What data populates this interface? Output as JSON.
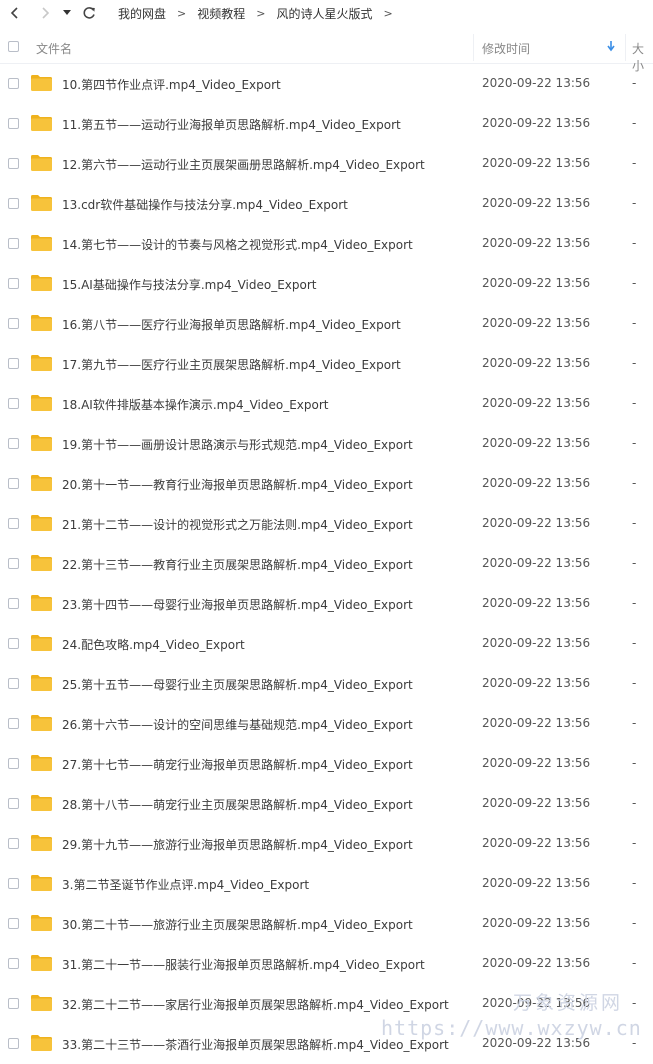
{
  "toolbar": {
    "back_icon": "chevron-left-icon",
    "forward_icon": "chevron-right-icon",
    "dropdown_icon": "caret-down-icon",
    "refresh_icon": "refresh-icon"
  },
  "breadcrumb": {
    "items": [
      "我的网盘",
      "视频教程",
      "风的诗人星火版式"
    ],
    "separator": ">"
  },
  "table": {
    "headers": {
      "name": "文件名",
      "time": "修改时间",
      "size": "大小"
    },
    "sort_icon": "sort-down-arrow-icon",
    "rows": [
      {
        "name": "10.第四节作业点评.mp4_Video_Export",
        "time": "2020-09-22 13:56",
        "size": "-"
      },
      {
        "name": "11.第五节——运动行业海报单页思路解析.mp4_Video_Export",
        "time": "2020-09-22 13:56",
        "size": "-"
      },
      {
        "name": "12.第六节——运动行业主页展架画册思路解析.mp4_Video_Export",
        "time": "2020-09-22 13:56",
        "size": "-"
      },
      {
        "name": "13.cdr软件基础操作与技法分享.mp4_Video_Export",
        "time": "2020-09-22 13:56",
        "size": "-"
      },
      {
        "name": "14.第七节——设计的节奏与风格之视觉形式.mp4_Video_Export",
        "time": "2020-09-22 13:56",
        "size": "-"
      },
      {
        "name": "15.AI基础操作与技法分享.mp4_Video_Export",
        "time": "2020-09-22 13:56",
        "size": "-"
      },
      {
        "name": "16.第八节——医疗行业海报单页思路解析.mp4_Video_Export",
        "time": "2020-09-22 13:56",
        "size": "-"
      },
      {
        "name": "17.第九节——医疗行业主页展架思路解析.mp4_Video_Export",
        "time": "2020-09-22 13:56",
        "size": "-"
      },
      {
        "name": "18.AI软件排版基本操作演示.mp4_Video_Export",
        "time": "2020-09-22 13:56",
        "size": "-"
      },
      {
        "name": "19.第十节——画册设计思路演示与形式规范.mp4_Video_Export",
        "time": "2020-09-22 13:56",
        "size": "-"
      },
      {
        "name": "20.第十一节——教育行业海报单页思路解析.mp4_Video_Export",
        "time": "2020-09-22 13:56",
        "size": "-"
      },
      {
        "name": "21.第十二节——设计的视觉形式之万能法则.mp4_Video_Export",
        "time": "2020-09-22 13:56",
        "size": "-"
      },
      {
        "name": "22.第十三节——教育行业主页展架思路解析.mp4_Video_Export",
        "time": "2020-09-22 13:56",
        "size": "-"
      },
      {
        "name": "23.第十四节——母婴行业海报单页思路解析.mp4_Video_Export",
        "time": "2020-09-22 13:56",
        "size": "-"
      },
      {
        "name": "24.配色攻略.mp4_Video_Export",
        "time": "2020-09-22 13:56",
        "size": "-"
      },
      {
        "name": "25.第十五节——母婴行业主页展架思路解析.mp4_Video_Export",
        "time": "2020-09-22 13:56",
        "size": "-"
      },
      {
        "name": "26.第十六节——设计的空间思维与基础规范.mp4_Video_Export",
        "time": "2020-09-22 13:56",
        "size": "-"
      },
      {
        "name": "27.第十七节——萌宠行业海报单页思路解析.mp4_Video_Export",
        "time": "2020-09-22 13:56",
        "size": "-"
      },
      {
        "name": "28.第十八节——萌宠行业主页展架思路解析.mp4_Video_Export",
        "time": "2020-09-22 13:56",
        "size": "-"
      },
      {
        "name": "29.第十九节——旅游行业海报单页思路解析.mp4_Video_Export",
        "time": "2020-09-22 13:56",
        "size": "-"
      },
      {
        "name": "3.第二节圣诞节作业点评.mp4_Video_Export",
        "time": "2020-09-22 13:56",
        "size": "-"
      },
      {
        "name": "30.第二十节——旅游行业主页展架思路解析.mp4_Video_Export",
        "time": "2020-09-22 13:56",
        "size": "-"
      },
      {
        "name": "31.第二十一节——服装行业海报单页思路解析.mp4_Video_Export",
        "time": "2020-09-22 13:56",
        "size": "-"
      },
      {
        "name": "32.第二十二节——家居行业海报单页展架思路解析.mp4_Video_Export",
        "time": "2020-09-22 13:56",
        "size": "-"
      },
      {
        "name": "33.第二十三节——茶酒行业海报单页展架思路解析.mp4_Video_Export",
        "time": "2020-09-22 13:56",
        "size": "-"
      }
    ]
  },
  "watermark": {
    "text": "万象资源网",
    "url": "https://www.wxzyw.cn"
  },
  "colors": {
    "folder": "#f7c33b",
    "folder_tab": "#efb21d",
    "sort_arrow": "#3a8ee6",
    "checkbox_border": "#b9bec8"
  }
}
